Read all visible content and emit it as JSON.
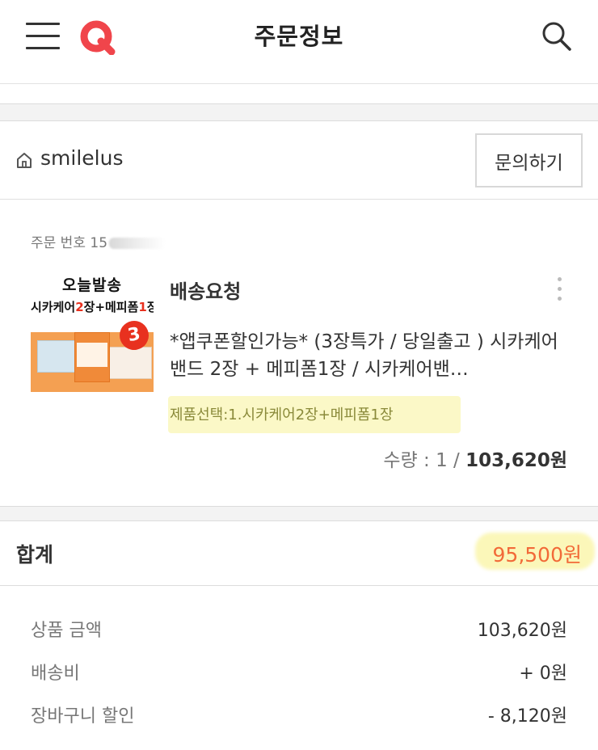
{
  "header": {
    "title": "주문정보",
    "menu_icon": "hamburger-menu-icon",
    "logo": "Q",
    "logo_color": "#f0454b",
    "search_icon": "search-icon"
  },
  "seller": {
    "name": "smilelus",
    "icon": "home-icon",
    "inquiry_label": "문의하기"
  },
  "order": {
    "order_number_label": "주문 번호",
    "order_number_visible": "15",
    "thumbnail": {
      "line1": "오늘발송",
      "line2_prefix": "시카케어",
      "line2_num1": "2",
      "line2_mid": "장+메피폼",
      "line2_num2": "1",
      "line2_suffix": "장",
      "badge": "3"
    },
    "status": "배송요청",
    "product_title": "*앱쿠폰할인가능* (3장특가 / 당일출고 ) 시카케어 밴드 2장 + 메피폼1장 / 시카케어밴…",
    "option": "제품선택:1.시카케어2장+메피폼1장",
    "quantity_text": "수량 : 1 / ",
    "price": "103,620원"
  },
  "total": {
    "label": "합계",
    "value": "95,500원",
    "value_color": "#f26a38"
  },
  "summary": [
    {
      "label": "상품 금액",
      "value": "103,620원"
    },
    {
      "label": "배송비",
      "value": "+ 0원"
    },
    {
      "label": "장바구니 할인",
      "value": "- 8,120원"
    }
  ]
}
